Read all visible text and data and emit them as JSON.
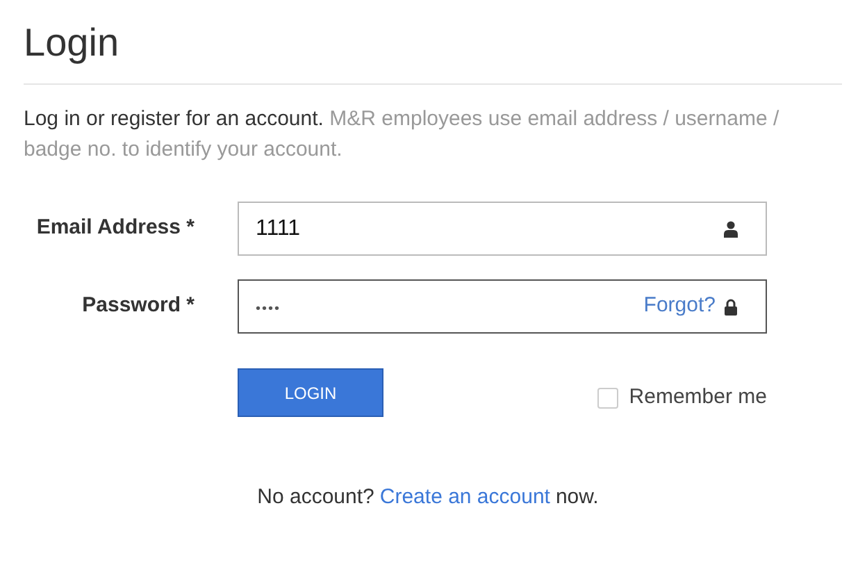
{
  "title": "Login",
  "intro": {
    "text": "Log in or register for an account.",
    "note": "M&R employees use email address / username / badge no. to identify your account."
  },
  "fields": [
    {
      "label": "Email Address *",
      "value": "1111",
      "kind": "user",
      "focused": false
    },
    {
      "label": "Password *",
      "value": "••••",
      "kind": "password",
      "focused": true,
      "link": "Forgot?"
    }
  ],
  "login_button": "LOGIN",
  "remember_me": {
    "label": "Remember me",
    "checked": false
  },
  "footer": {
    "before": "No account?",
    "link": "Create an account",
    "after": "now."
  }
}
